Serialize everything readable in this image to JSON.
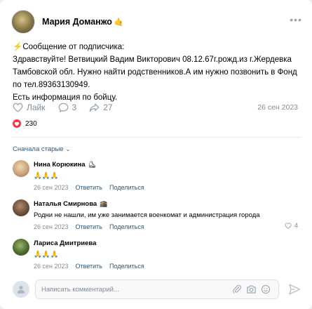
{
  "post": {
    "author": "Мария Доманжо",
    "author_emoji": "🤙",
    "more": "•••",
    "lines": [
      "⚡Сообщение от подписчика:",
      "Здравствуйте! Ветвицкий Вадим Викторович 08.12.67г.рожд.из г.Жердевка",
      "Тамбовской обл. Нужно найти родственников.А им нужно позвонить в Фонд",
      "по тел.89363130949.",
      "Есть информация по бойцу."
    ],
    "actions": {
      "like_label": "Лайк",
      "comments_count": "3",
      "shares_count": "27"
    },
    "date": "26 сен 2023",
    "likes_count": "230"
  },
  "comments_sort": "Сначала старые",
  "comments": [
    {
      "name": "Нина Корюкина",
      "tag": "⛸",
      "text": "🙏🙏🙏",
      "date": "26 сен 2023",
      "reply": "Ответить",
      "share": "Поделиться",
      "likes": "",
      "avatar_color": "#c9a27a"
    },
    {
      "name": "Наталья Смирнова",
      "tag": "🕋",
      "text": "Родни не нашли, им уже занимается военкомат и администрация города",
      "date": "26 сен 2023",
      "reply": "Ответить",
      "share": "Поделиться",
      "likes": "4",
      "avatar_color": "#6c4f3d"
    },
    {
      "name": "Лариса Дмитриева",
      "tag": "",
      "text": "🙏🙏🙏",
      "date": "26 сен 2023",
      "reply": "Ответить",
      "share": "Поделиться",
      "likes": "",
      "avatar_color": "#4d6b2f"
    }
  ],
  "composer": {
    "placeholder": "Написать комментарий..."
  },
  "colors": {
    "link": "#2a5885",
    "muted": "#818c99",
    "heart": "#ff3347",
    "accent": "#99a2ad"
  }
}
